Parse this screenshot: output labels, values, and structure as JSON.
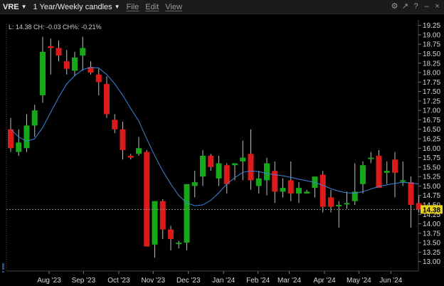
{
  "titlebar": {
    "symbol": "VRE",
    "period": "1 Year/Weekly candles",
    "menus": [
      "File",
      "Edit",
      "View"
    ],
    "icons": [
      "gear-icon",
      "link-icon",
      "help-icon",
      "minimize-icon",
      "close-icon"
    ],
    "icon_glyphs": [
      "⚙",
      "↗",
      "?",
      "‒",
      "×"
    ]
  },
  "colors": {
    "background": "#000000",
    "up": "#17a81a",
    "down": "#dc1a1a",
    "ma": "#3c86d8",
    "last_price": "#e8d21d",
    "axis_text": "#d8d8d8"
  },
  "chart_data": {
    "type": "candlestick",
    "info_line": "L: 14.38  CH: -0.03  CH%: -0.21%",
    "last_price": 14.38,
    "y_ticks": [
      13.0,
      13.25,
      13.5,
      13.75,
      14.0,
      14.25,
      14.5,
      14.75,
      15.0,
      15.25,
      15.5,
      15.75,
      16.0,
      16.25,
      16.5,
      16.75,
      17.0,
      17.25,
      17.5,
      17.75,
      18.0,
      18.25,
      18.5,
      18.75,
      19.0,
      19.25
    ],
    "y_tick_labels": [
      "13.00",
      "13.25",
      "13.50",
      "13.75",
      "14.00",
      "14.25",
      "14.50",
      "14.75",
      "15.00",
      "15.25",
      "15.50",
      "15.75",
      "16.00",
      "16.25",
      "16.50",
      "16.75",
      "17.00",
      "17.25",
      "17.50",
      "17.75",
      "18.00",
      "18.25",
      "18.50",
      "18.75",
      "19.00",
      "19.25"
    ],
    "ylim": [
      12.75,
      19.45
    ],
    "x_labels": [
      {
        "label": "Aug '23",
        "index": 4.8
      },
      {
        "label": "Sep '23",
        "index": 9.1
      },
      {
        "label": "Oct '23",
        "index": 13.5
      },
      {
        "label": "Nov '23",
        "index": 17.8
      },
      {
        "label": "Dec '23",
        "index": 22.2
      },
      {
        "label": "Jan '24",
        "index": 26.6
      },
      {
        "label": "Feb '24",
        "index": 30.9
      },
      {
        "label": "Mar '24",
        "index": 34.8
      },
      {
        "label": "Apr '24",
        "index": 39.2
      },
      {
        "label": "May '24",
        "index": 43.5
      },
      {
        "label": "Jun '24",
        "index": 47.5
      }
    ],
    "candles": [
      {
        "o": 16.5,
        "h": 16.8,
        "l": 15.9,
        "c": 16.0
      },
      {
        "o": 15.9,
        "h": 16.5,
        "l": 15.8,
        "c": 16.15
      },
      {
        "o": 16.0,
        "h": 16.9,
        "l": 15.9,
        "c": 16.6
      },
      {
        "o": 16.6,
        "h": 17.15,
        "l": 16.3,
        "c": 17.0
      },
      {
        "o": 17.4,
        "h": 18.95,
        "l": 17.2,
        "c": 18.55
      },
      {
        "o": 18.7,
        "h": 18.9,
        "l": 17.95,
        "c": 18.65
      },
      {
        "o": 18.65,
        "h": 18.85,
        "l": 18.3,
        "c": 18.45
      },
      {
        "o": 18.3,
        "h": 18.6,
        "l": 17.95,
        "c": 18.1
      },
      {
        "o": 18.05,
        "h": 18.55,
        "l": 17.9,
        "c": 18.4
      },
      {
        "o": 18.45,
        "h": 18.95,
        "l": 18.05,
        "c": 18.65
      },
      {
        "o": 18.15,
        "h": 18.3,
        "l": 17.95,
        "c": 18.0
      },
      {
        "o": 17.95,
        "h": 18.1,
        "l": 17.4,
        "c": 17.75
      },
      {
        "o": 17.7,
        "h": 17.9,
        "l": 16.8,
        "c": 16.9
      },
      {
        "o": 16.75,
        "h": 16.9,
        "l": 16.4,
        "c": 16.5
      },
      {
        "o": 16.5,
        "h": 16.7,
        "l": 15.7,
        "c": 15.95
      },
      {
        "o": 15.8,
        "h": 15.85,
        "l": 15.7,
        "c": 15.75
      },
      {
        "o": 15.85,
        "h": 16.3,
        "l": 15.8,
        "c": 16.0
      },
      {
        "o": 15.9,
        "h": 15.95,
        "l": 13.4,
        "c": 13.4
      },
      {
        "o": 13.45,
        "h": 14.55,
        "l": 13.1,
        "c": 14.6
      },
      {
        "o": 14.6,
        "h": 14.65,
        "l": 13.6,
        "c": 13.85
      },
      {
        "o": 13.85,
        "h": 13.95,
        "l": 13.3,
        "c": 13.6
      },
      {
        "o": 13.5,
        "h": 13.55,
        "l": 13.35,
        "c": 13.5
      },
      {
        "o": 13.5,
        "h": 15.05,
        "l": 13.3,
        "c": 15.05
      },
      {
        "o": 15.0,
        "h": 15.4,
        "l": 14.7,
        "c": 15.1
      },
      {
        "o": 15.25,
        "h": 15.95,
        "l": 15.0,
        "c": 15.8
      },
      {
        "o": 15.8,
        "h": 15.85,
        "l": 15.4,
        "c": 15.5
      },
      {
        "o": 15.2,
        "h": 15.8,
        "l": 15.0,
        "c": 15.6
      },
      {
        "o": 15.55,
        "h": 15.6,
        "l": 14.8,
        "c": 15.05
      },
      {
        "o": 15.55,
        "h": 15.6,
        "l": 15.15,
        "c": 15.6
      },
      {
        "o": 15.65,
        "h": 16.2,
        "l": 15.15,
        "c": 15.75
      },
      {
        "o": 15.85,
        "h": 16.5,
        "l": 14.9,
        "c": 15.15
      },
      {
        "o": 15.0,
        "h": 15.4,
        "l": 14.8,
        "c": 15.2
      },
      {
        "o": 15.15,
        "h": 15.75,
        "l": 14.75,
        "c": 15.6
      },
      {
        "o": 15.4,
        "h": 15.65,
        "l": 14.55,
        "c": 14.85
      },
      {
        "o": 14.85,
        "h": 15.2,
        "l": 14.7,
        "c": 14.95
      },
      {
        "o": 15.15,
        "h": 15.65,
        "l": 14.6,
        "c": 14.8
      },
      {
        "o": 14.8,
        "h": 15.1,
        "l": 14.55,
        "c": 14.95
      },
      {
        "o": 14.8,
        "h": 14.9,
        "l": 14.8,
        "c": 14.85
      },
      {
        "o": 14.95,
        "h": 15.25,
        "l": 14.7,
        "c": 15.25
      },
      {
        "o": 15.3,
        "h": 15.4,
        "l": 14.3,
        "c": 14.45
      },
      {
        "o": 14.7,
        "h": 14.9,
        "l": 14.3,
        "c": 14.45
      },
      {
        "o": 14.5,
        "h": 14.6,
        "l": 13.9,
        "c": 14.5
      },
      {
        "o": 14.55,
        "h": 14.85,
        "l": 14.4,
        "c": 14.55
      },
      {
        "o": 14.6,
        "h": 15.6,
        "l": 14.5,
        "c": 14.85
      },
      {
        "o": 15.05,
        "h": 15.65,
        "l": 14.8,
        "c": 15.55
      },
      {
        "o": 15.75,
        "h": 15.9,
        "l": 15.6,
        "c": 15.75
      },
      {
        "o": 15.8,
        "h": 15.95,
        "l": 14.95,
        "c": 14.95
      },
      {
        "o": 15.35,
        "h": 15.65,
        "l": 15.05,
        "c": 15.4
      },
      {
        "o": 15.7,
        "h": 15.9,
        "l": 14.7,
        "c": 15.35
      },
      {
        "o": 15.15,
        "h": 15.65,
        "l": 15.0,
        "c": 15.15
      },
      {
        "o": 15.1,
        "h": 15.25,
        "l": 13.9,
        "c": 14.5
      },
      {
        "o": 14.55,
        "h": 14.75,
        "l": 14.3,
        "c": 14.38
      }
    ],
    "moving_average": [
      16.5,
      16.3,
      16.18,
      16.25,
      16.55,
      16.95,
      17.35,
      17.7,
      17.92,
      18.08,
      18.14,
      18.12,
      17.95,
      17.7,
      17.4,
      17.05,
      16.72,
      16.25,
      15.8,
      15.4,
      15.05,
      14.75,
      14.55,
      14.48,
      14.5,
      14.62,
      14.82,
      15.05,
      15.22,
      15.36,
      15.4,
      15.38,
      15.33,
      15.3,
      15.27,
      15.23,
      15.18,
      15.14,
      15.09,
      15.02,
      14.93,
      14.86,
      14.82,
      14.81,
      14.85,
      14.92,
      14.99,
      15.03,
      15.07,
      15.1,
      15.08,
      15.05
    ]
  }
}
